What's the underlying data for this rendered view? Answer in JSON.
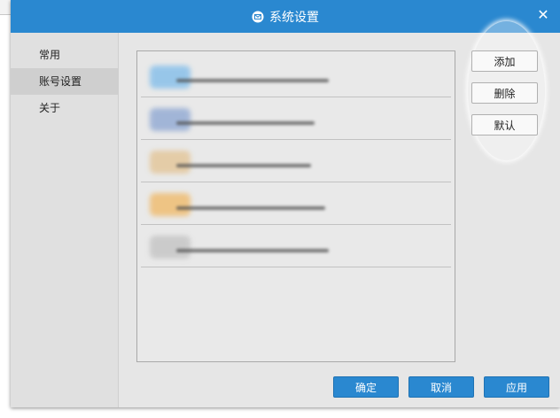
{
  "window": {
    "title": "系统设置",
    "title_icon": "mail-icon",
    "close_icon": "close-icon",
    "close_glyph": "✕"
  },
  "sidebar": {
    "items": [
      {
        "label": "常用"
      },
      {
        "label": "账号设置",
        "active": true
      },
      {
        "label": "关于"
      }
    ]
  },
  "accounts": {
    "rows": [
      {
        "icon_color": "#8fc3ea"
      },
      {
        "icon_color": "#9ab0d6"
      },
      {
        "icon_color": "#e4c9a0"
      },
      {
        "icon_color": "#efc07a"
      },
      {
        "icon_color": "#c8c8c8"
      }
    ]
  },
  "actions": {
    "add": "添加",
    "delete": "删除",
    "default": "默认"
  },
  "footer": {
    "ok": "确定",
    "cancel": "取消",
    "apply": "应用"
  },
  "colors": {
    "accent": "#2a88d0"
  }
}
